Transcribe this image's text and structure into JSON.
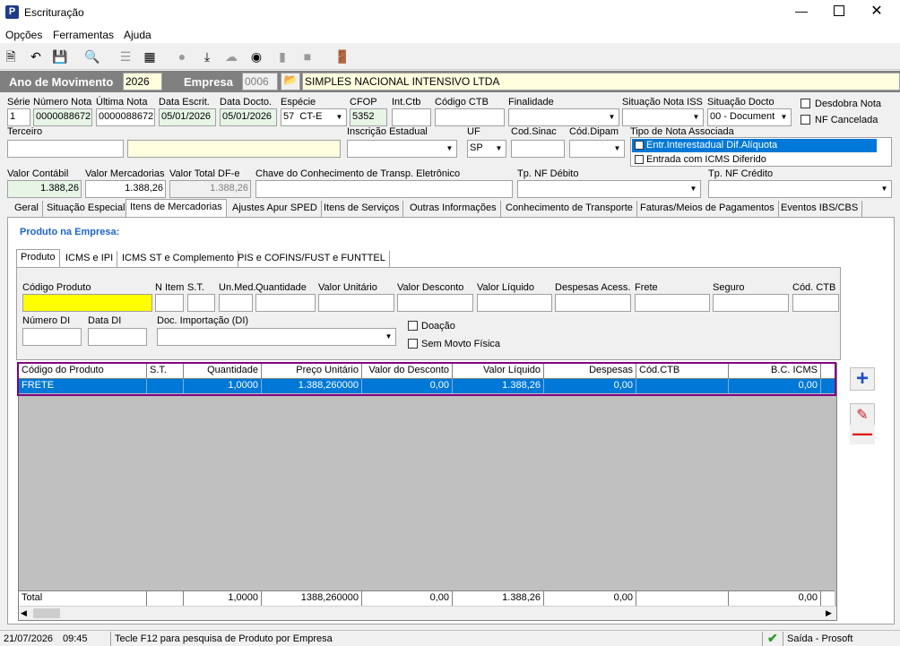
{
  "window": {
    "title": "Escrituração"
  },
  "menu": [
    "Opções",
    "Ferramentas",
    "Ajuda"
  ],
  "header": {
    "ano_label": "Ano de Movimento",
    "ano_value": "2026",
    "empresa_label": "Empresa",
    "empresa_code": "0006",
    "empresa_name": "SIMPLES NACIONAL INTENSIVO LTDA"
  },
  "labels": {
    "serie": "Série",
    "numero_nota": "Número Nota",
    "ultima_nota": "Última Nota",
    "data_escrit": "Data Escrit.",
    "data_docto": "Data Docto.",
    "especie": "Espécie",
    "cfop": "CFOP",
    "int_ctb": "Int.Ctb",
    "codigo_ctb": "Código CTB",
    "finalidade": "Finalidade",
    "situacao_iss": "Situação Nota ISS",
    "situacao_docto": "Situação Docto",
    "desdobra": "Desdobra Nota",
    "nf_cancelada": "NF Cancelada",
    "terceiro": "Terceiro",
    "inscricao": "Inscrição Estadual",
    "uf": "UF",
    "cod_sinac": "Cod.Sinac",
    "cod_dipam": "Cód.Dipam",
    "tipo_nota": "Tipo de Nota Associada",
    "valor_contabil": "Valor Contábil",
    "valor_mercadorias": "Valor Mercadorias",
    "valor_total_dfe": "Valor Total DF-e",
    "chave": "Chave do Conhecimento de Transp. Eletrônico",
    "tp_debito": "Tp. NF Débito",
    "tp_credito": "Tp. NF Crédito"
  },
  "values": {
    "serie": "1",
    "numero_nota": "0000088672",
    "ultima_nota": "0000088672",
    "data_escrit": "05/01/2026",
    "data_docto": "05/01/2026",
    "especie_code": "57",
    "especie": "CT-E",
    "cfop": "5352",
    "situacao_docto": "00 - Document",
    "uf": "SP",
    "valor_contabil": "1.388,26",
    "valor_mercadorias": "1.388,26",
    "valor_total_dfe": "1.388,26"
  },
  "tipo_nota_options": [
    "Entr.Interestadual Dif.Alíquota",
    "Entrada com ICMS Diferido"
  ],
  "tabs": [
    "Geral",
    "Situação Especial",
    "Itens de Mercadorias",
    "Ajustes Apur SPED",
    "Itens de Serviços",
    "Outras Informações",
    "Conhecimento de Transporte",
    "Faturas/Meios de Pagamentos",
    "Eventos IBS/CBS"
  ],
  "section_title": "Produto na Empresa:",
  "product_tabs": [
    "Produto",
    "ICMS e IPI",
    "ICMS ST e Complemento",
    "PIS e COFINS/FUST e FUNTTEL"
  ],
  "product_labels": {
    "codigo_produto": "Código Produto",
    "n_item": "N Item",
    "st": "S.T.",
    "un_med": "Un.Med.",
    "quantidade": "Quantidade",
    "valor_unitario": "Valor Unitário",
    "valor_desconto": "Valor Desconto",
    "valor_liquido": "Valor Líquido",
    "despesas": "Despesas Acess.",
    "frete": "Frete",
    "seguro": "Seguro",
    "cod_ctb": "Cód. CTB",
    "numero_di": "Número DI",
    "data_di": "Data DI",
    "doc_importacao": "Doc. Importação (DI)",
    "doacao": "Doação",
    "sem_movto": "Sem Movto Física"
  },
  "grid": {
    "headers": [
      "Código do Produto",
      "S.T.",
      "Quantidade",
      "Preço Unitário",
      "Valor do Desconto",
      "Valor Líquido",
      "Despesas",
      "Cód.CTB",
      "B.C. ICMS"
    ],
    "rows": [
      [
        "FRETE",
        "",
        "1,0000",
        "1.388,260000",
        "0,00",
        "1.388,26",
        "0,00",
        "",
        "0,00"
      ]
    ],
    "total": [
      "Total",
      "",
      "1,0000",
      "1388,260000",
      "0,00",
      "1.388,26",
      "0,00",
      "",
      "0,00"
    ]
  },
  "status": {
    "date": "21/07/2026",
    "time": "09:45",
    "hint": "Tecle F12 para pesquisa de Produto por Empresa",
    "exit": "Saída - Prosoft"
  },
  "colors": {
    "selection": "#0078d7",
    "highlight_yellow": "#ffff00",
    "header_bar": "#808080",
    "border_purple": "#800080"
  }
}
